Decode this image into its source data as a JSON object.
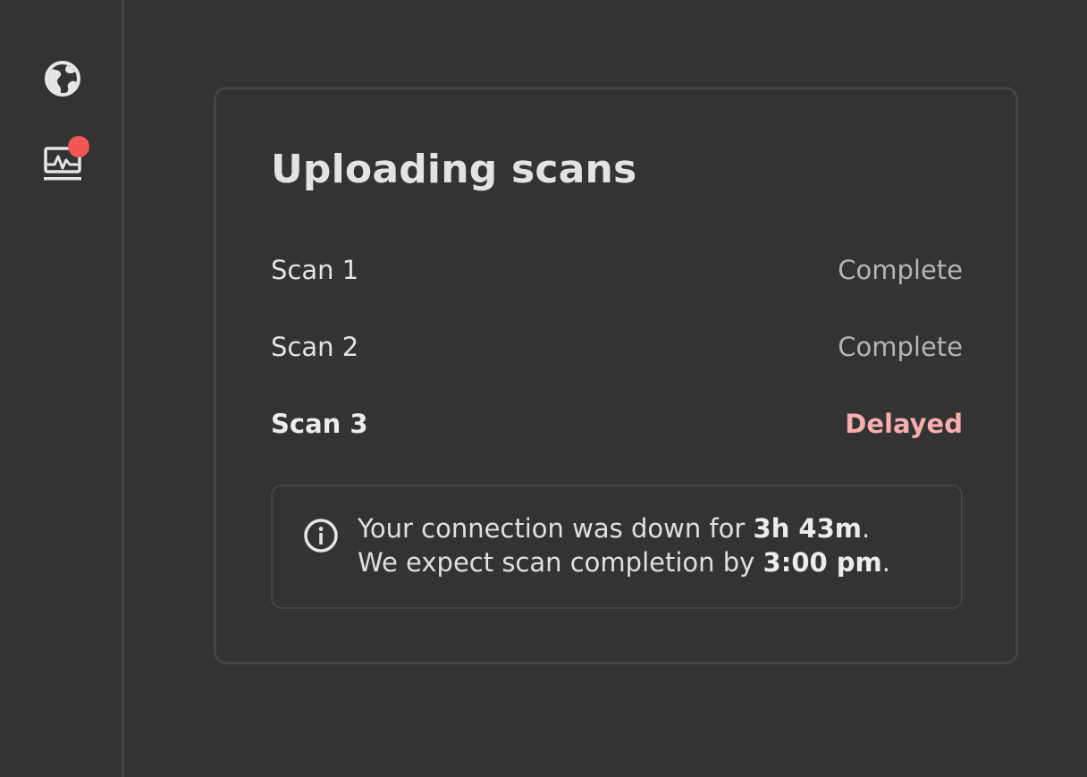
{
  "sidebar": {
    "items": [
      {
        "icon": "globe-icon",
        "has_badge": false
      },
      {
        "icon": "monitor-chart-icon",
        "has_badge": true
      }
    ],
    "badge_color": "#f25757"
  },
  "card": {
    "title": "Uploading scans",
    "scans": [
      {
        "name": "Scan 1",
        "status": "Complete"
      },
      {
        "name": "Scan 2",
        "status": "Complete"
      },
      {
        "name": "Scan 3",
        "status": "Delayed"
      }
    ],
    "delayed_color": "#f7aeae",
    "info": {
      "line1_prefix": "Your connection was down for ",
      "line1_value": "3h 43m",
      "line1_suffix": ".",
      "line2_prefix": "We expect scan completion by ",
      "line2_value": "3:00 pm",
      "line2_suffix": "."
    }
  }
}
